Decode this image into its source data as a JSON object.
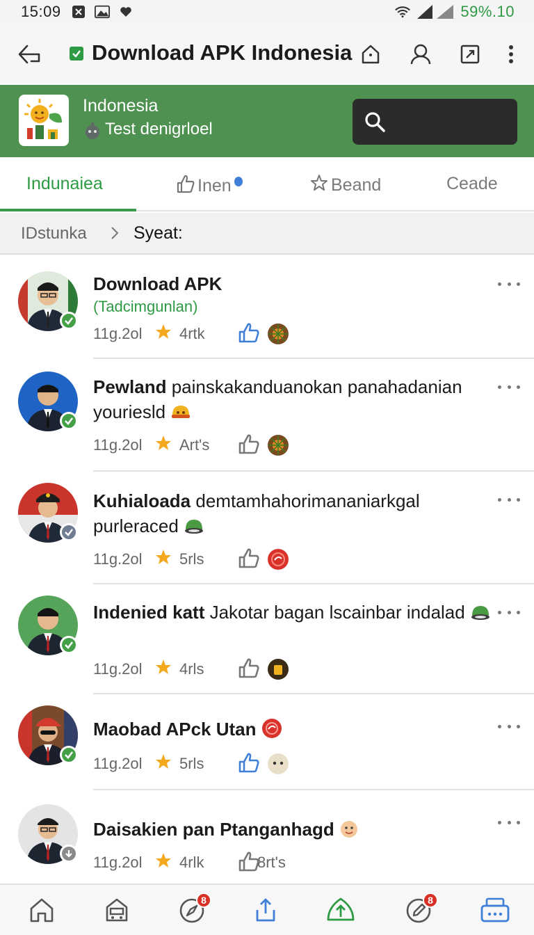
{
  "status_bar": {
    "time": "15:09",
    "battery": "59%.10",
    "icons": [
      "notification-icon",
      "gallery-icon",
      "heart-icon",
      "wifi-icon",
      "signal-icon"
    ]
  },
  "browser": {
    "title": "Download APK Indonesia",
    "actions": [
      "home-icon",
      "profile-icon",
      "bookmark-icon",
      "menu-icon"
    ]
  },
  "app": {
    "name": "Indonesia",
    "subtitle": "Test denigrloel",
    "search_placeholder": ""
  },
  "tabs": [
    {
      "label": "Indunaiea",
      "active": true
    },
    {
      "label": "Inen",
      "icon": "thumb-icon",
      "dot": true
    },
    {
      "label": "Beand",
      "icon": "star-icon"
    },
    {
      "label": "Ceade"
    }
  ],
  "breadcrumb": {
    "root": "IDstunka",
    "separator": ">",
    "current": "Syeat:"
  },
  "feed": [
    {
      "title_bold": "Download APK",
      "title_rest": "",
      "subtitle": "(Tadcimgunlan)",
      "date": "11g.2ol",
      "count": "4rtk",
      "liked": true,
      "badge": "verified"
    },
    {
      "title_bold": "Pewland",
      "title_rest": "painskakanduanokan panahadanian youriesld",
      "subtitle": "",
      "date": "11g.2ol",
      "count": "Art's",
      "liked": false,
      "badge": "verified"
    },
    {
      "title_bold": "Kuhialoada",
      "title_rest": "demtamhahorimananiarkgal purleraced",
      "subtitle": "",
      "date": "11g.2ol",
      "count": "5rls",
      "liked": false,
      "badge": "pending"
    },
    {
      "title_bold": "Indenied katt",
      "title_rest": "Jakotar bagan lscainbar indalad",
      "subtitle": "",
      "date": "11g.2ol",
      "count": "4rls",
      "liked": false,
      "badge": "verified"
    },
    {
      "title_bold": "Maobad APck Utan",
      "title_rest": "",
      "subtitle": "",
      "date": "11g.2ol",
      "count": "5rls",
      "liked": true,
      "badge": "verified"
    },
    {
      "title_bold": "Daisakien pan Ptanganhagd",
      "title_rest": "",
      "subtitle": "",
      "date": "11g.2ol",
      "count": "4rlk",
      "liked": false,
      "like_label": "8rt's",
      "badge": "download"
    }
  ],
  "bottom_nav": [
    {
      "icon": "home-icon"
    },
    {
      "icon": "store-icon"
    },
    {
      "icon": "compass-icon",
      "badge": "8"
    },
    {
      "icon": "share-icon"
    },
    {
      "icon": "upload-icon"
    },
    {
      "icon": "pencil-icon",
      "badge": "8"
    },
    {
      "icon": "chat-icon"
    }
  ],
  "colors": {
    "brand_green": "#4e9150",
    "accent_green": "#2e9a44",
    "like_blue": "#3f7fd8",
    "badge_red": "#d93025"
  }
}
